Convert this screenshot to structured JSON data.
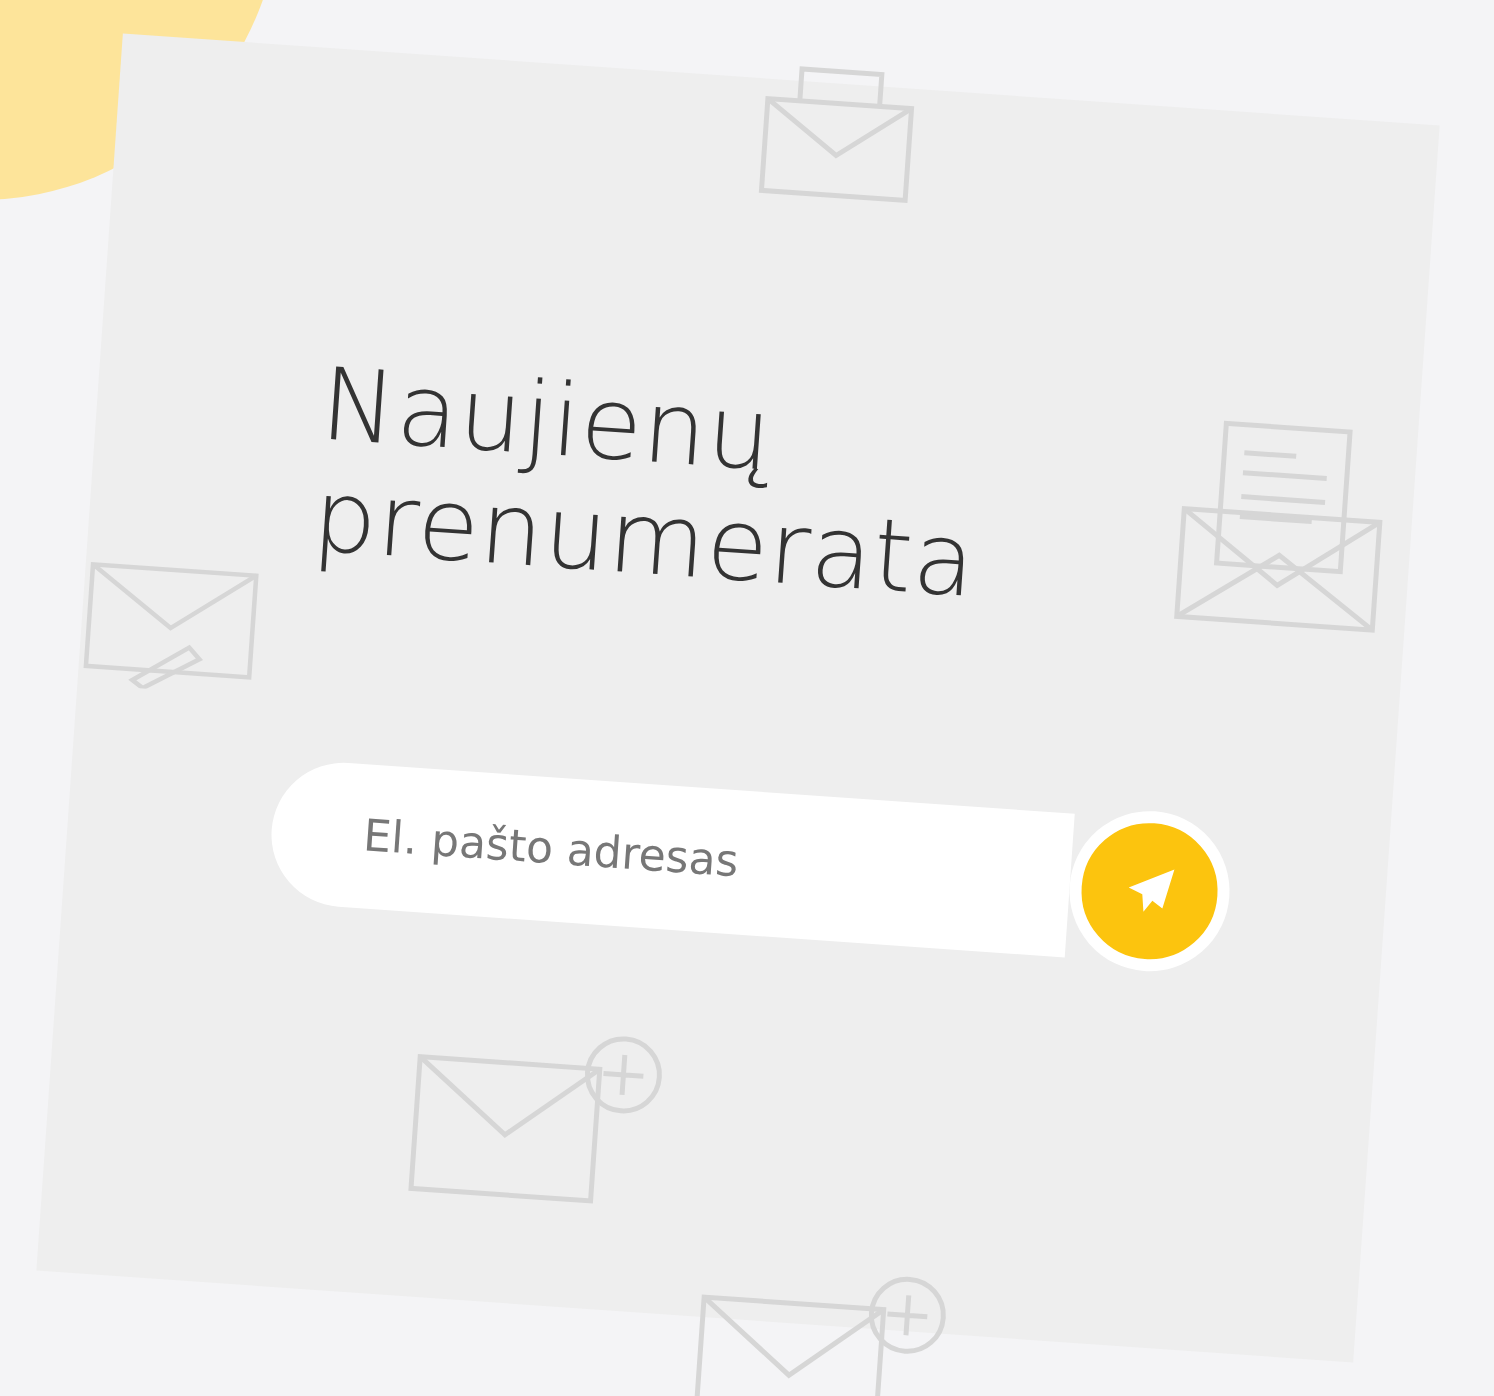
{
  "newsletter": {
    "title": "Naujienų prenumerata",
    "email_field": {
      "placeholder": "El. pašto adresas"
    }
  }
}
